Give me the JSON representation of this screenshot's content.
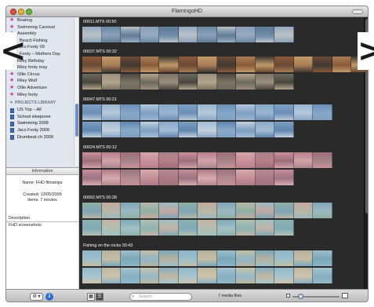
{
  "window": {
    "title": "FlamingoHD"
  },
  "nav": {
    "prev_glyph": "<",
    "next_glyph": ">"
  },
  "source_list": {
    "items": [
      {
        "label": "Boating",
        "indent": false
      },
      {
        "label": "Swimming Carnival",
        "indent": false
      },
      {
        "label": "Assembly",
        "indent": false
      },
      {
        "label": "Beach Fishing",
        "indent": true
      },
      {
        "label": "Jacs Footy 09",
        "indent": false
      },
      {
        "label": "Footy – Mothers Day",
        "indent": true
      },
      {
        "label": "Riley Birthday",
        "indent": false
      },
      {
        "label": "Riley footy may",
        "indent": false
      },
      {
        "label": "Ollie Circus",
        "indent": false
      },
      {
        "label": "Riley Wolf",
        "indent": false
      },
      {
        "label": "Ollie Adventure",
        "indent": false
      },
      {
        "label": "Riley footy",
        "indent": false
      }
    ],
    "projects_header": "PROJECTS LIBRARY",
    "projects": [
      {
        "label": "US Trip – All"
      },
      {
        "label": "School sleepover"
      },
      {
        "label": "Swimming 2009"
      },
      {
        "label": "Jacs Footy 2009"
      },
      {
        "label": "Drumbeat ch 2009"
      }
    ]
  },
  "info_panel": {
    "header": "Information",
    "name_line": "Name: FHD filmstrips",
    "created_line": "Created: 13/05/2009",
    "items_line": "Items: 7 movies",
    "description_label": "Description",
    "description_text": "FHD screenshots"
  },
  "clips": [
    {
      "title": "00011.MTS 00:50",
      "rows": [
        {
          "frames": 11,
          "palette": [
            "#97aac1",
            "#6d8aa7",
            "#b9c1c8",
            "#8aa0b8",
            "#5f7c98"
          ]
        }
      ]
    },
    {
      "title": "00037.MTS 00:32",
      "rows": [
        {
          "frames": 15,
          "palette": [
            "#8a5a3a",
            "#c29b6a",
            "#6b4a36",
            "#a87d55",
            "#3f3a33"
          ]
        },
        {
          "frames": 11,
          "palette": [
            "#6b6a5e",
            "#9a8f7e",
            "#4a4640",
            "#b3a58c",
            "#7d7466"
          ]
        }
      ]
    },
    {
      "title": "00047.MTS 00:21",
      "rows": [
        {
          "frames": 13,
          "palette": [
            "#7fa0c4",
            "#9ab6d0",
            "#6c8fb7",
            "#b6c8da",
            "#86a8c8"
          ]
        },
        {
          "frames": 11,
          "palette": [
            "#7c9ec2",
            "#a5bcd4",
            "#5f86b0",
            "#c2d0de",
            "#8aa9c9"
          ]
        }
      ]
    },
    {
      "title": "00024.MTS 00:12",
      "rows": [
        {
          "frames": 13,
          "palette": [
            "#c8909a",
            "#b87f8b",
            "#9c6e7a",
            "#d4a3aa",
            "#a8848a"
          ]
        },
        {
          "frames": 11,
          "palette": [
            "#c58e98",
            "#ad7a86",
            "#9a7480",
            "#d9aab0",
            "#b38a90"
          ]
        }
      ]
    },
    {
      "title": "00092.MTS 00:28",
      "rows": [
        {
          "frames": 13,
          "palette": [
            "#8fb0a4",
            "#c2a9a0",
            "#7fa6b6",
            "#b7b7a5",
            "#9cb9c2"
          ]
        },
        {
          "frames": 11,
          "palette": [
            "#8db3b0",
            "#c4b3a6",
            "#7eaab8",
            "#b3bfb0",
            "#a3c0c4"
          ]
        }
      ]
    },
    {
      "title": "Fishing on the rocks 00:43",
      "rows": [
        {
          "frames": 13,
          "palette": [
            "#8fb6c7",
            "#b7b29d",
            "#9bbfcc",
            "#c5bea6",
            "#7aa7bb"
          ]
        },
        {
          "frames": 13,
          "palette": [
            "#92b9c9",
            "#bfb8a2",
            "#a6c5d0",
            "#cbc3ac",
            "#86afc1"
          ]
        }
      ]
    }
  ],
  "bottom_bar": {
    "gear_label": "⚙ ▾",
    "info_label": "i",
    "grid_label": "▦",
    "list_label": "☰",
    "search_placeholder": "Search",
    "search_icon": "⌕",
    "count_text": "7 media files"
  }
}
